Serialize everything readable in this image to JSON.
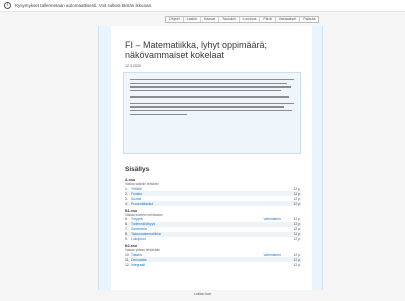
{
  "info_bar": {
    "text": "Kysymykset tallennetaan automaattisesti. Voit sulkea tämän ikkunan."
  },
  "toolbar": {
    "buttons": [
      "Ohjeet",
      "Laskin",
      "Kaavat",
      "Taulukot",
      "Luonnos",
      "Piirrä",
      "Vastaukset",
      "Palauta"
    ]
  },
  "exam": {
    "title": "FI – Matematiikka, lyhyt oppimäärä; näkövammaiset kokelaat",
    "date": "12.3.2020",
    "toc_title": "Sisällys",
    "sections": [
      {
        "title": "A-osa",
        "subtitle": "Vastaa kaikkiin tehtäviin",
        "items": [
          {
            "num": "1.",
            "label": "Yhtälöt",
            "marker": "",
            "points": "12 p."
          },
          {
            "num": "2.",
            "label": "Funktio",
            "marker": "",
            "points": "12 p."
          },
          {
            "num": "3.",
            "label": "Suorat",
            "marker": "",
            "points": "12 p."
          },
          {
            "num": "4.",
            "label": "Prosenttilaskut",
            "marker": "",
            "points": "12 p."
          }
        ]
      },
      {
        "title": "B1-osa",
        "subtitle": "Vastaa kolmeen tehtävään",
        "items": [
          {
            "num": "5.",
            "label": "Ympyrä",
            "marker": "Valinnainen",
            "points": "12 p."
          },
          {
            "num": "6.",
            "label": "Todennäköisyys",
            "marker": "",
            "points": "12 p."
          },
          {
            "num": "7.",
            "label": "Geometria",
            "marker": "",
            "points": "12 p."
          },
          {
            "num": "8.",
            "label": "Talousmatematiikka",
            "marker": "",
            "points": "12 p."
          },
          {
            "num": "9.",
            "label": "Lukujonot",
            "marker": "",
            "points": "12 p."
          }
        ]
      },
      {
        "title": "B2-osa",
        "subtitle": "Vastaa yhteen tehtävään",
        "items": [
          {
            "num": "10.",
            "label": "Tilastot",
            "marker": "Valinnainen",
            "points": "12 p."
          },
          {
            "num": "11.",
            "label": "Derivaatta",
            "marker": "",
            "points": "12 p."
          },
          {
            "num": "12.",
            "label": "Integraali",
            "marker": "",
            "points": "12 p."
          }
        ]
      }
    ]
  },
  "footer": {
    "text": "Lukion koe"
  }
}
